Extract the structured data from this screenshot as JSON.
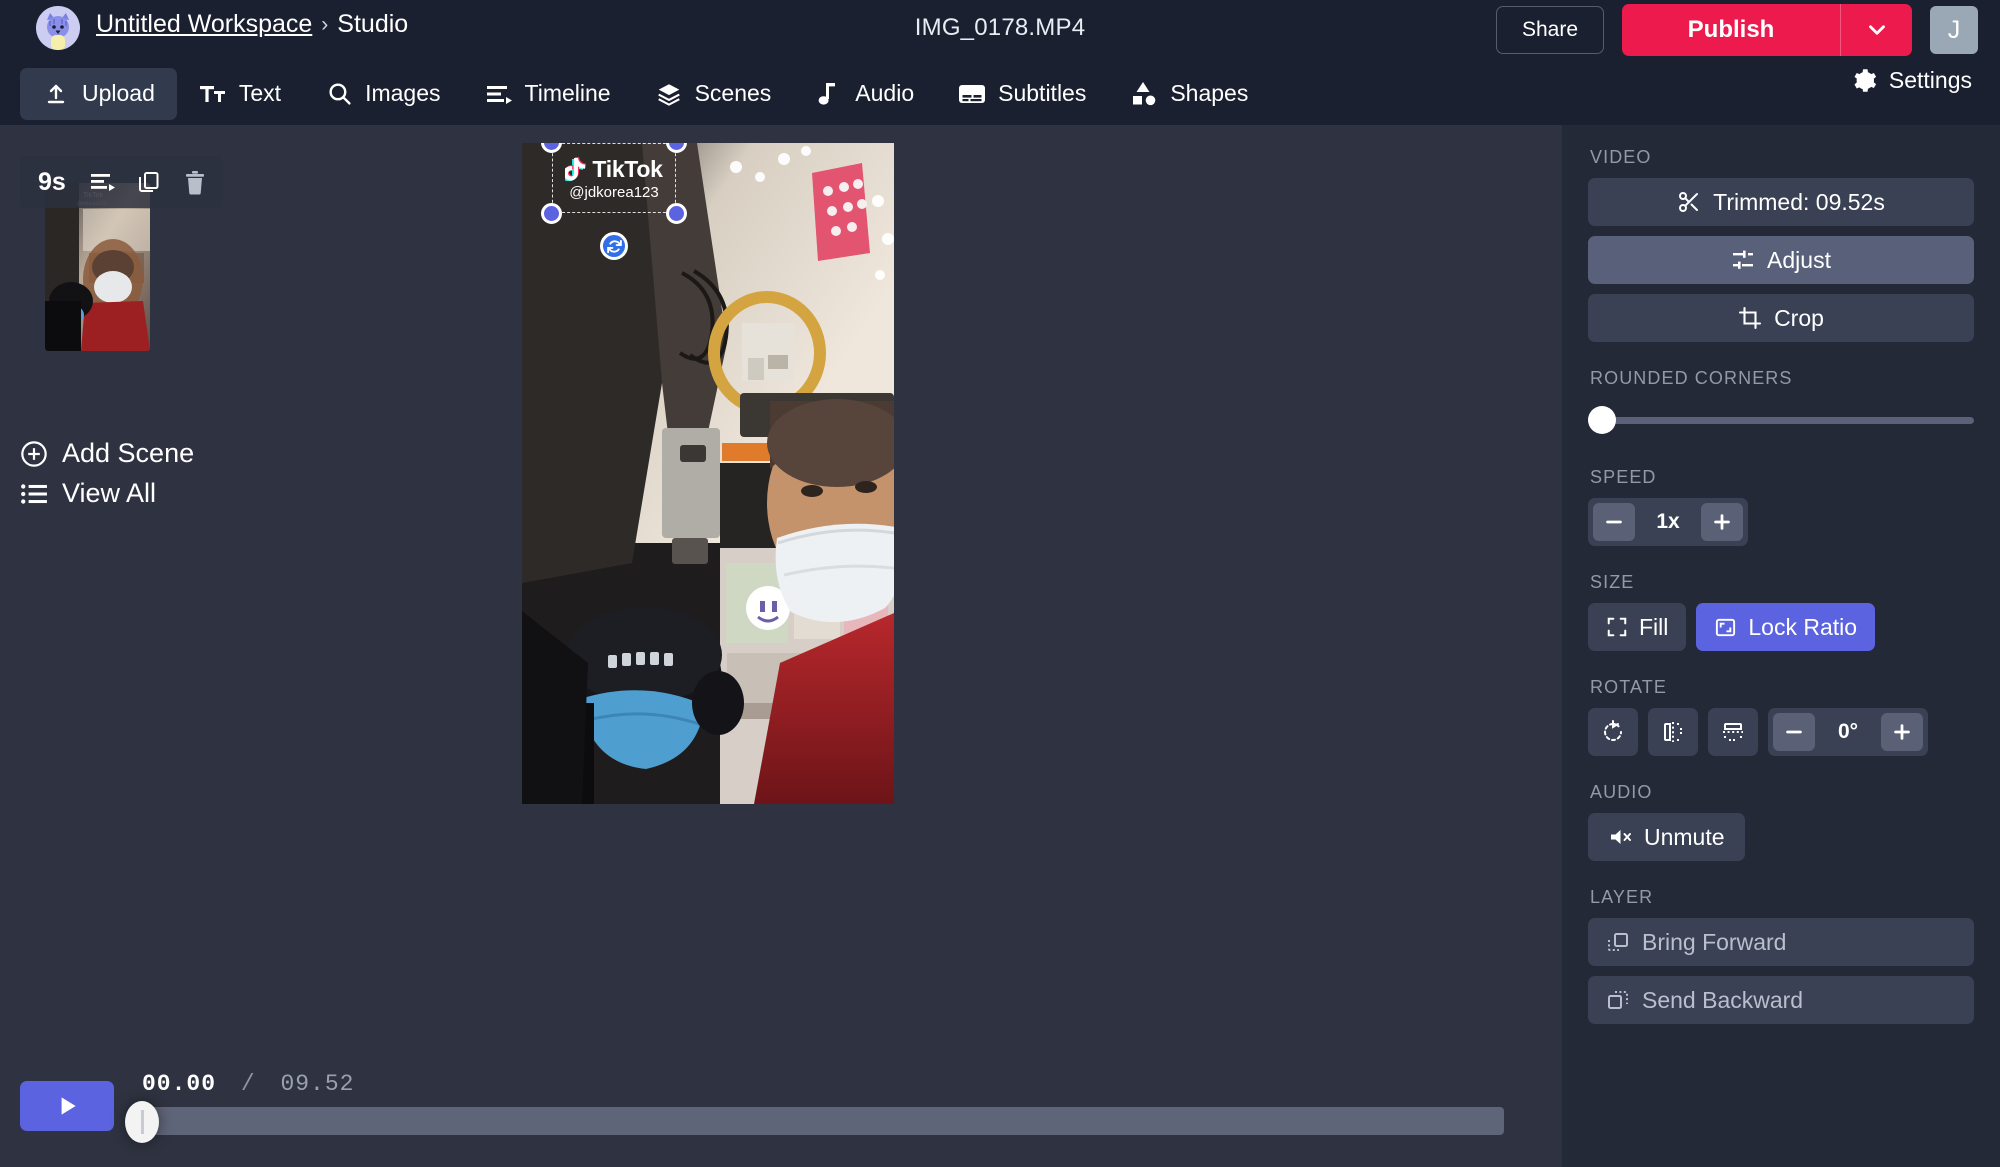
{
  "header": {
    "workspace": "Untitled Workspace",
    "separator": "›",
    "section": "Studio",
    "document_title": "IMG_0178.MP4",
    "share_label": "Share",
    "publish_label": "Publish",
    "user_initial": "J",
    "accent_publish": "#ed1b4d",
    "accent_primary": "#5b63e0"
  },
  "nav": {
    "items": [
      {
        "label": "Upload",
        "icon": "upload-icon",
        "active": true
      },
      {
        "label": "Text",
        "icon": "text-icon",
        "active": false
      },
      {
        "label": "Images",
        "icon": "search-icon",
        "active": false
      },
      {
        "label": "Timeline",
        "icon": "timeline-icon",
        "active": false
      },
      {
        "label": "Scenes",
        "icon": "layers-icon",
        "active": false
      },
      {
        "label": "Audio",
        "icon": "music-note-icon",
        "active": false
      },
      {
        "label": "Subtitles",
        "icon": "subtitles-icon",
        "active": false
      },
      {
        "label": "Shapes",
        "icon": "shapes-icon",
        "active": false
      }
    ],
    "settings_label": "Settings"
  },
  "scenes": {
    "duration_badge": "9s",
    "add_scene_label": "Add Scene",
    "view_all_label": "View All"
  },
  "canvas": {
    "watermark_brand": "TikTok",
    "watermark_handle": "@jdkorea123",
    "selected": true
  },
  "properties": {
    "video_label": "VIDEO",
    "trimmed_label": "Trimmed: 09.52s",
    "adjust_label": "Adjust",
    "crop_label": "Crop",
    "rounded_corners_label": "ROUNDED CORNERS",
    "rounded_corners_value": 0,
    "speed_label": "SPEED",
    "speed_value": "1x",
    "size_label": "SIZE",
    "fill_label": "Fill",
    "lock_ratio_label": "Lock Ratio",
    "rotate_label": "ROTATE",
    "rotate_value": "0°",
    "audio_label": "AUDIO",
    "unmute_label": "Unmute",
    "layer_label": "LAYER",
    "bring_forward_label": "Bring Forward",
    "send_backward_label": "Send Backward"
  },
  "playback": {
    "current_time": "00.00",
    "separator": "/",
    "total_time": "09.52",
    "progress_percent": 0
  }
}
